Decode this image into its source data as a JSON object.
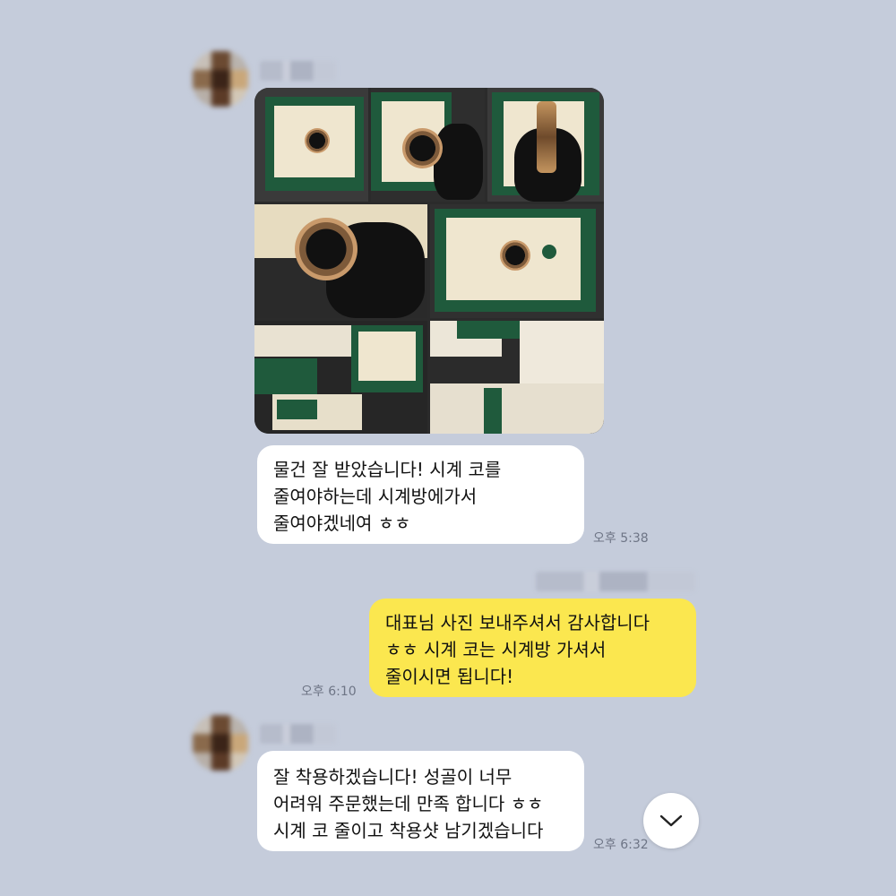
{
  "messages": [
    {
      "id": "m1",
      "sender": "other",
      "type": "photo-grid",
      "photo_count": 8
    },
    {
      "id": "m2",
      "sender": "other",
      "lines": [
        "물건 잘 받았습니다! 시계 코를",
        "줄여야하는데 시계방에가서",
        "줄여야겠네여 ㅎㅎ"
      ],
      "time": "오후 5:38"
    },
    {
      "id": "m3",
      "sender": "me",
      "lines": [
        "대표님 사진 보내주셔서 감사합니다",
        "ㅎㅎ 시계 코는 시계방 가셔서",
        "줄이시면 됩니다!"
      ],
      "time": "오후 6:10"
    },
    {
      "id": "m4",
      "sender": "other",
      "lines": [
        "잘 착용하겠습니다! 성골이 너무",
        "어려워 주문했는데 만족 합니다 ㅎㅎ",
        "시계 코 줄이고 착용샷 남기겠습니다"
      ],
      "time": "오후 6:32"
    }
  ],
  "icons": {
    "scroll_down": "chevron-down-icon",
    "avatar": "blurred-avatar"
  },
  "colors": {
    "background": "#c5ccdb",
    "incoming_bubble": "#ffffff",
    "outgoing_bubble": "#fbe74f",
    "time_text": "#6e7586"
  }
}
